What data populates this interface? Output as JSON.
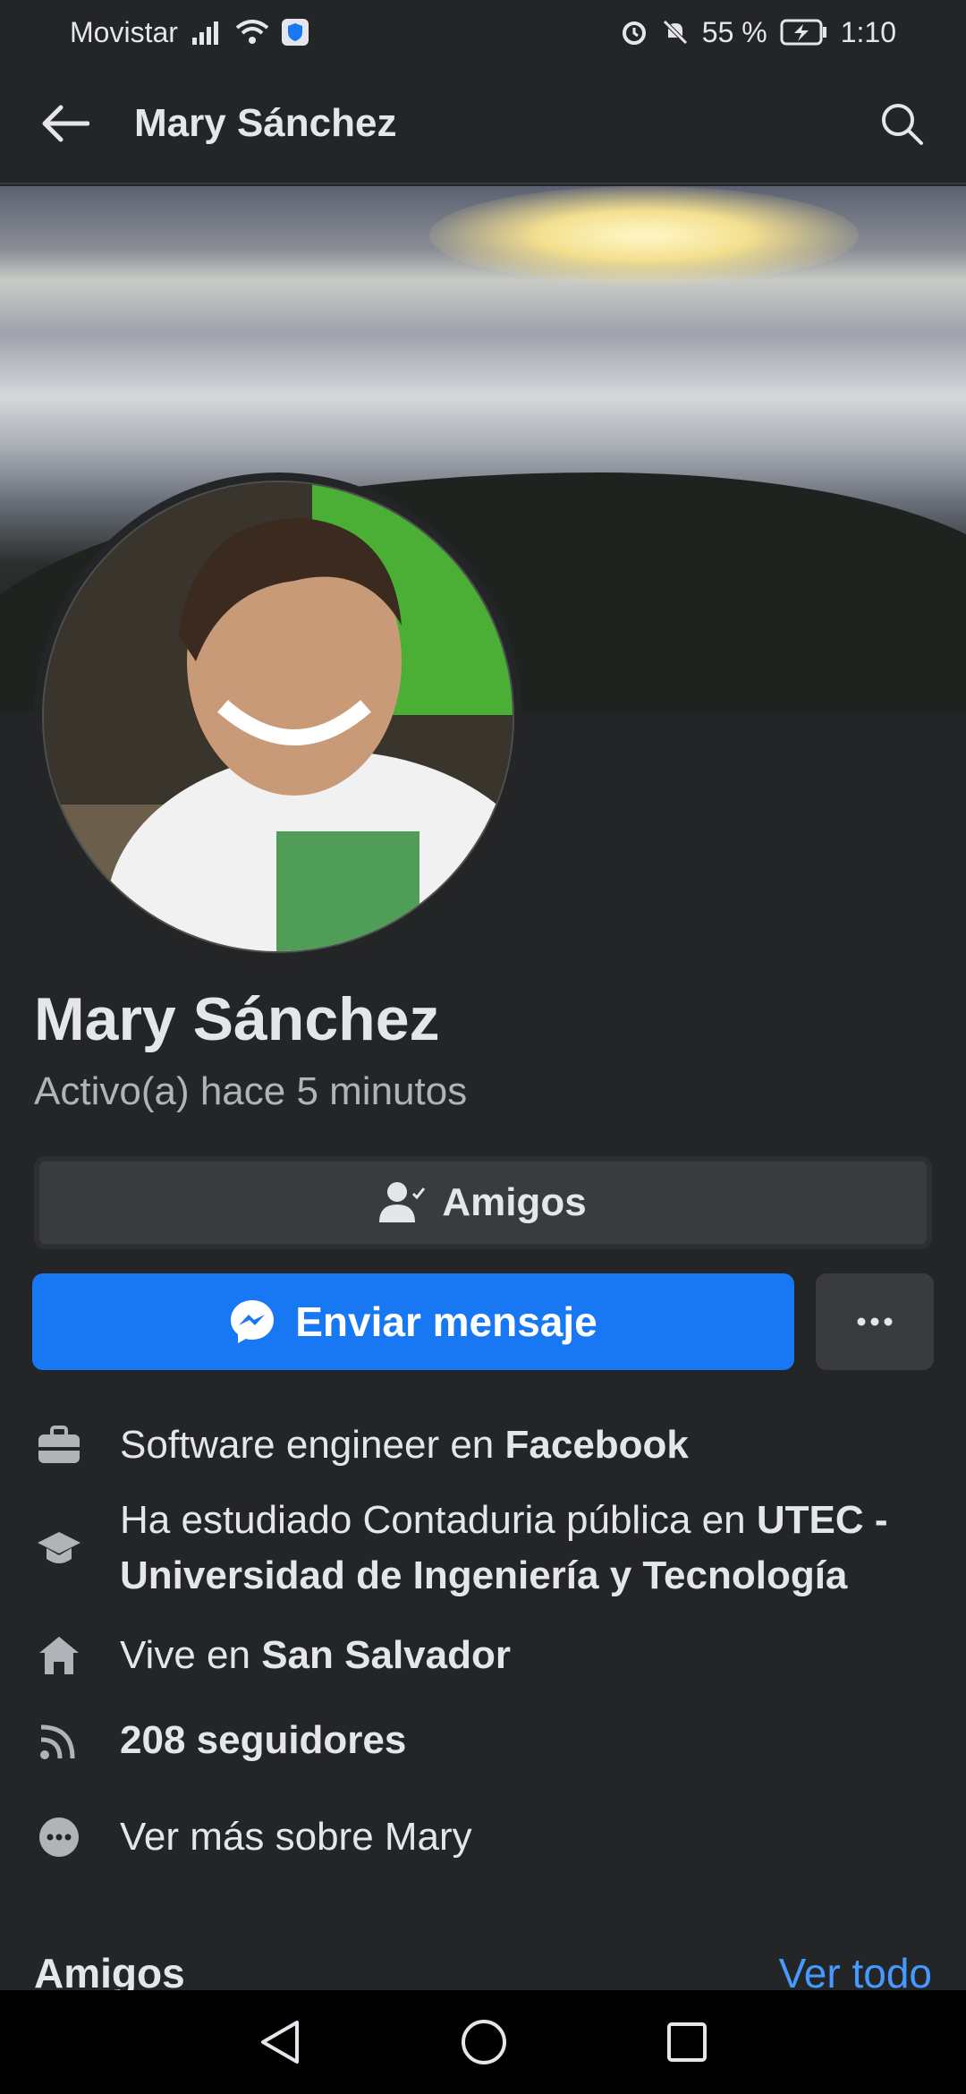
{
  "status_bar": {
    "carrier": "Movistar",
    "battery": "55 %",
    "time": "1:10"
  },
  "app_bar": {
    "title": "Mary Sánchez"
  },
  "profile": {
    "name": "Mary Sánchez",
    "last_active": "Activo(a) hace 5 minutos"
  },
  "actions": {
    "friends_label": "Amigos",
    "message_label": "Enviar mensaje"
  },
  "about": {
    "work_prefix": "Software engineer en ",
    "work_place": "Facebook",
    "study_prefix": "Ha estudiado Contaduria pública en ",
    "study_place": "UTEC - Universidad de Ingeniería y Tecnología",
    "lives_prefix": "Vive en ",
    "lives_place": "San Salvador",
    "followers": "208 seguidores",
    "see_more": "Ver más sobre Mary"
  },
  "friends_section": {
    "title": "Amigos",
    "see_all": "Ver todo"
  },
  "icons": {
    "back": "arrow-left-icon",
    "search": "search-icon",
    "friends": "friend-check-icon",
    "messenger": "messenger-icon",
    "more": "more-horizontal-icon",
    "work": "briefcase-icon",
    "study": "graduation-cap-icon",
    "home": "home-icon",
    "followers": "rss-feed-icon",
    "see_more": "more-circle-icon"
  },
  "colors": {
    "background": "#242526",
    "primary": "#1877f2",
    "link": "#4599ff",
    "secondary_text": "#b0b3b8"
  }
}
